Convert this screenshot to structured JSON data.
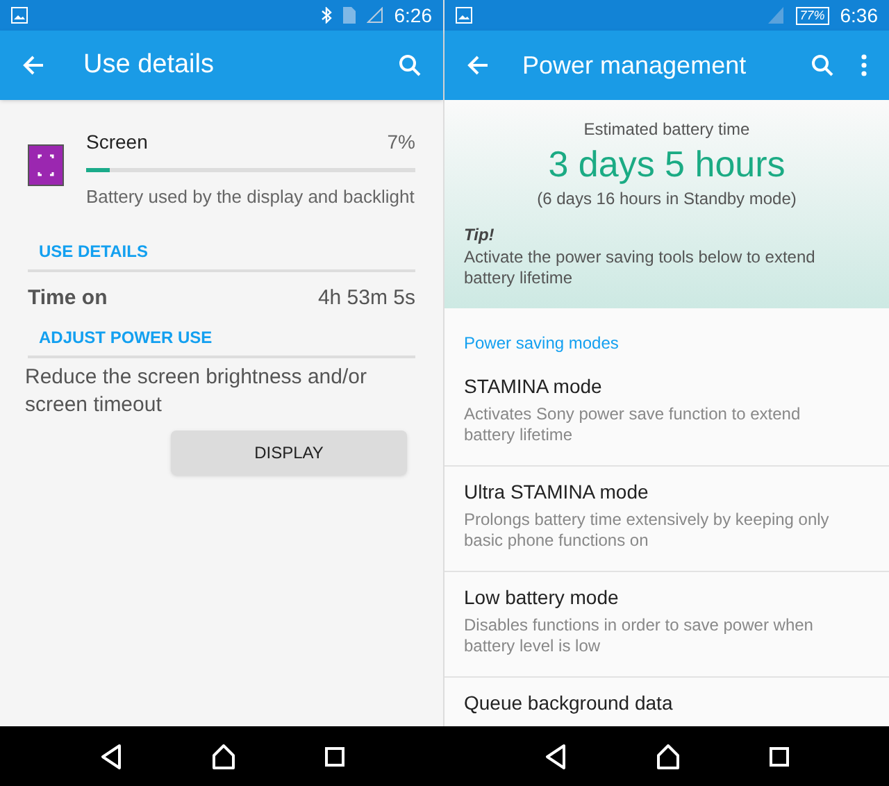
{
  "left": {
    "status_bar": {
      "time": "6:26"
    },
    "app_bar": {
      "title": "Use details"
    },
    "usage": {
      "name": "Screen",
      "percent": "7%",
      "level": 0.07,
      "description": "Battery used by the display and backlight"
    },
    "use_details": {
      "heading": "USE DETAILS",
      "label": "Time on",
      "value": "4h 53m 5s"
    },
    "adjust": {
      "heading": "ADJUST POWER USE",
      "text": "Reduce the screen brightness and/or screen timeout",
      "button": "DISPLAY"
    }
  },
  "right": {
    "status_bar": {
      "time": "6:36",
      "battery": "77%"
    },
    "app_bar": {
      "title": "Power management"
    },
    "estimate": {
      "label": "Estimated battery time",
      "value": "3 days 5 hours",
      "standby": "(6 days 16 hours in Standby mode)",
      "tip_title": "Tip!",
      "tip": "Activate the power saving tools below to extend battery lifetime"
    },
    "section": "Power saving modes",
    "items": [
      {
        "title": "STAMINA mode",
        "subtitle": "Activates Sony power save function to extend battery lifetime"
      },
      {
        "title": "Ultra STAMINA mode",
        "subtitle": "Prolongs battery time extensively by keeping only basic phone functions on"
      },
      {
        "title": "Low battery mode",
        "subtitle": "Disables functions in order to save power when battery level is low"
      },
      {
        "title": "Queue background data"
      }
    ]
  }
}
